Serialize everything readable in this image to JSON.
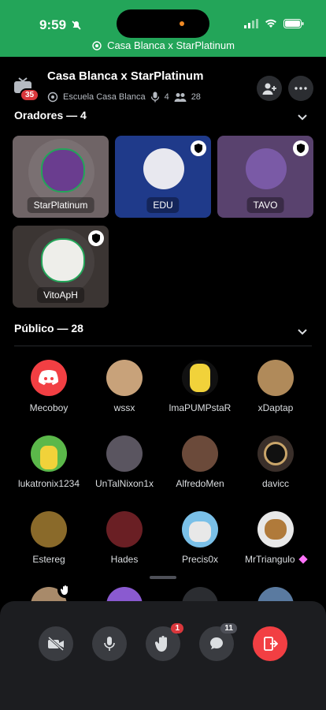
{
  "status": {
    "time": "9:59",
    "banner": "Casa Blanca x StarPlatinum"
  },
  "header": {
    "badge": "35",
    "title": "Casa Blanca x StarPlatinum",
    "server": "Escuela Casa Blanca",
    "speakers_count": "4",
    "listeners_count": "28"
  },
  "speakers": {
    "heading": "Oradores — 4",
    "items": [
      {
        "name": "StarPlatinum",
        "bg": "#6f6466",
        "avatar": "#6a3d8f"
      },
      {
        "name": "EDU",
        "bg": "#1f3a8a",
        "avatar": "#e8e8ef"
      },
      {
        "name": "TAVO",
        "bg": "#59426e",
        "avatar": "#7a5aa6"
      },
      {
        "name": "VitoApH",
        "bg": "#3b3533",
        "avatar": "#eeeeea"
      }
    ]
  },
  "audience": {
    "heading": "Público — 28",
    "items": [
      {
        "name": "Mecoboy",
        "color": "#f23f43"
      },
      {
        "name": "wssx",
        "color": "#c8a27a"
      },
      {
        "name": "lmaPUMPstaR",
        "color": "#f1d23a"
      },
      {
        "name": "xDaptap",
        "color": "#b08a5a"
      },
      {
        "name": "lukatronix1234",
        "color": "#5bb84a"
      },
      {
        "name": "UnTalNixon1x",
        "color": "#5a5560"
      },
      {
        "name": "AlfredoMen",
        "color": "#6b4a3a"
      },
      {
        "name": "davicc",
        "color": "#3a2f2a"
      },
      {
        "name": "Estereg",
        "color": "#8a6a2a"
      },
      {
        "name": "Hades",
        "color": "#6a1f24"
      },
      {
        "name": "Precis0x",
        "color": "#7ac0e8"
      },
      {
        "name": "MrTriangulo",
        "color": "#e8e8e8"
      }
    ]
  },
  "controls": {
    "hand_count": "1",
    "chat_count": "11"
  }
}
